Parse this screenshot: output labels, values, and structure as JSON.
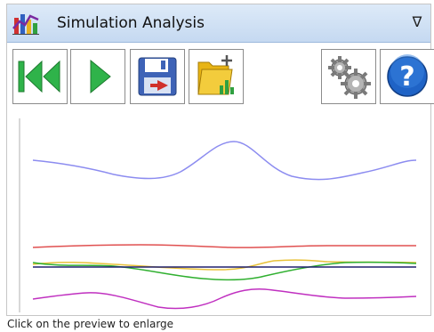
{
  "window": {
    "title": "Simulation Analysis",
    "collapse_glyph": "∇"
  },
  "toolbar": {
    "buttons": [
      {
        "name": "rewind-button",
        "icon": "rewind-icon",
        "color": "#2fb34a"
      },
      {
        "name": "play-button",
        "icon": "play-icon",
        "color": "#2fb34a"
      },
      {
        "name": "save-button",
        "icon": "save-icon",
        "color": "#3e63b7"
      },
      {
        "name": "export-button",
        "icon": "folder-export-icon",
        "color": "#e8b414"
      },
      {
        "name": "settings-button",
        "icon": "gears-icon",
        "color": "#8a8a8a"
      },
      {
        "name": "help-button",
        "icon": "help-icon",
        "color": "#1f63c6"
      }
    ]
  },
  "preview": {
    "series_colors": [
      "#8c8cf0",
      "#e05050",
      "#e8c23a",
      "#30b030",
      "#20206e",
      "#c030c0"
    ]
  },
  "status": {
    "hint": "Click on the preview to enlarge"
  }
}
